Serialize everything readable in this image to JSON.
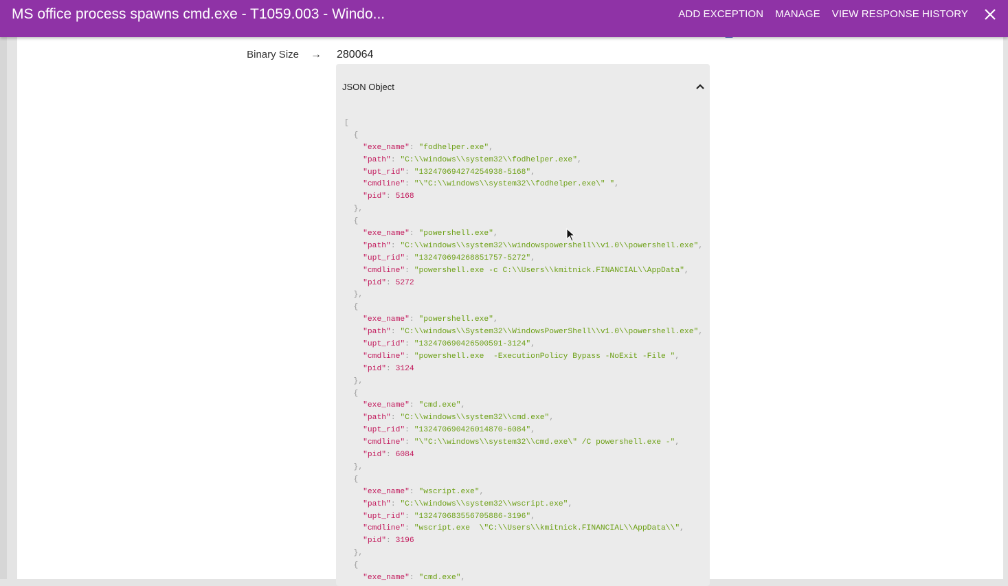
{
  "header": {
    "title": "MS office process spawns cmd.exe - T1059.003 - Windo...",
    "actions": [
      "ADD EXCEPTION",
      "MANAGE",
      "VIEW RESPONSE HISTORY"
    ],
    "background": "#8f33a6"
  },
  "fields": {
    "binary_size_label": "Binary Size",
    "arrow": "→",
    "binary_size_value": "280064"
  },
  "json_panel": {
    "title": "JSON Object",
    "processes": [
      {
        "exe_name": "fodhelper.exe",
        "path": "C:\\\\windows\\\\system32\\\\fodhelper.exe",
        "upt_rid": "132470694274254938-5168",
        "cmdline": "\\\"C:\\\\windows\\\\system32\\\\fodhelper.exe\\\" ",
        "pid": 5168
      },
      {
        "exe_name": "powershell.exe",
        "path": "C:\\\\windows\\\\system32\\\\windowspowershell\\\\v1.0\\\\powershell.exe",
        "upt_rid": "132470694268851757-5272",
        "cmdline": "powershell.exe -c C:\\\\Users\\\\kmitnick.FINANCIAL\\\\AppData",
        "pid": 5272
      },
      {
        "exe_name": "powershell.exe",
        "path": "C:\\\\windows\\\\System32\\\\WindowsPowerShell\\\\v1.0\\\\powershell.exe",
        "upt_rid": "132470690426500591-3124",
        "cmdline": "powershell.exe  -ExecutionPolicy Bypass -NoExit -File ",
        "pid": 3124
      },
      {
        "exe_name": "cmd.exe",
        "path": "C:\\\\windows\\\\system32\\\\cmd.exe",
        "upt_rid": "132470690426014870-6084",
        "cmdline": "\\\"C:\\\\windows\\\\system32\\\\cmd.exe\\\" /C powershell.exe -",
        "pid": 6084
      },
      {
        "exe_name": "wscript.exe",
        "path": "C:\\\\windows\\\\system32\\\\wscript.exe",
        "upt_rid": "132470683556705886-3196",
        "cmdline": "wscript.exe  \\\"C:\\\\Users\\\\kmitnick.FINANCIAL\\\\AppData\\\\",
        "pid": 3196
      },
      {
        "exe_name": "cmd.exe"
      }
    ]
  }
}
